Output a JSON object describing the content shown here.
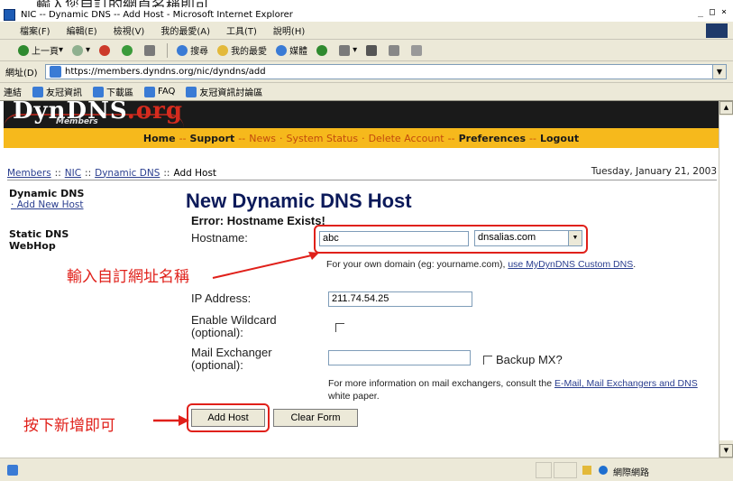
{
  "top_caption": "輸入您自訂的網頁名稱即可",
  "window": {
    "title": "NIC -- Dynamic DNS -- Add Host - Microsoft Internet Explorer",
    "min": "_",
    "max": "□",
    "close": "×"
  },
  "menubar": [
    "檔案(F)",
    "編輯(E)",
    "檢視(V)",
    "我的最愛(A)",
    "工具(T)",
    "說明(H)"
  ],
  "toolbar": {
    "back": "上一頁",
    "search": "搜尋",
    "favorites": "我的最愛",
    "media": "媒體"
  },
  "address": {
    "label": "網址(D)",
    "url": "https://members.dyndns.org/nic/dyndns/add"
  },
  "links": {
    "label": "連結",
    "items": [
      "友冠資訊",
      "下載區",
      "FAQ",
      "友冠資訊討論區"
    ]
  },
  "site": {
    "logo_main": "DynDNS",
    "logo_org": ".org",
    "logo_members": "Members",
    "nav": [
      {
        "label": "Home",
        "style": "bold"
      },
      {
        "label": "Support",
        "style": "bold"
      },
      {
        "label": "News",
        "style": "alt"
      },
      {
        "label": "System Status",
        "style": "alt"
      },
      {
        "label": "Delete Account",
        "style": "alt"
      },
      {
        "label": "Preferences",
        "style": "bold"
      },
      {
        "label": "Logout",
        "style": "bold"
      }
    ],
    "breadcrumb": [
      "Members",
      "NIC",
      "Dynamic DNS",
      "Add Host"
    ],
    "date": "Tuesday, January 21, 2003",
    "sidebar": {
      "heading": "Dynamic DNS",
      "add_new": "Add New Host",
      "static": "Static DNS",
      "webhop": "WebHop"
    },
    "title": "New Dynamic DNS Host",
    "error": "Error: Hostname Exists!"
  },
  "form": {
    "hostname_label": "Hostname:",
    "hostname_value": "abc",
    "domain_value": "dnsalias.com",
    "hostname_help": "For your own domain (eg: yourname.com),",
    "hostname_help_link": "use MyDynDNS Custom DNS",
    "ip_label": "IP Address:",
    "ip_value": "211.74.54.25",
    "wildcard_label_1": "Enable Wildcard",
    "wildcard_label_2": "(optional):",
    "mx_label_1": "Mail Exchanger",
    "mx_label_2": "(optional):",
    "mx_value": "",
    "backup_mx_label": "Backup MX?",
    "mx_help_1": "For more information on mail exchangers, consult the",
    "mx_help_link": "E-Mail, Mail Exchangers and DNS",
    "mx_help_2": "white paper.",
    "add_host": "Add Host",
    "clear_form": "Clear Form"
  },
  "annotations": {
    "hostname_note": "輸入自訂網址名稱",
    "button_note": "按下新增即可"
  },
  "status": {
    "zone": "網際網路"
  }
}
